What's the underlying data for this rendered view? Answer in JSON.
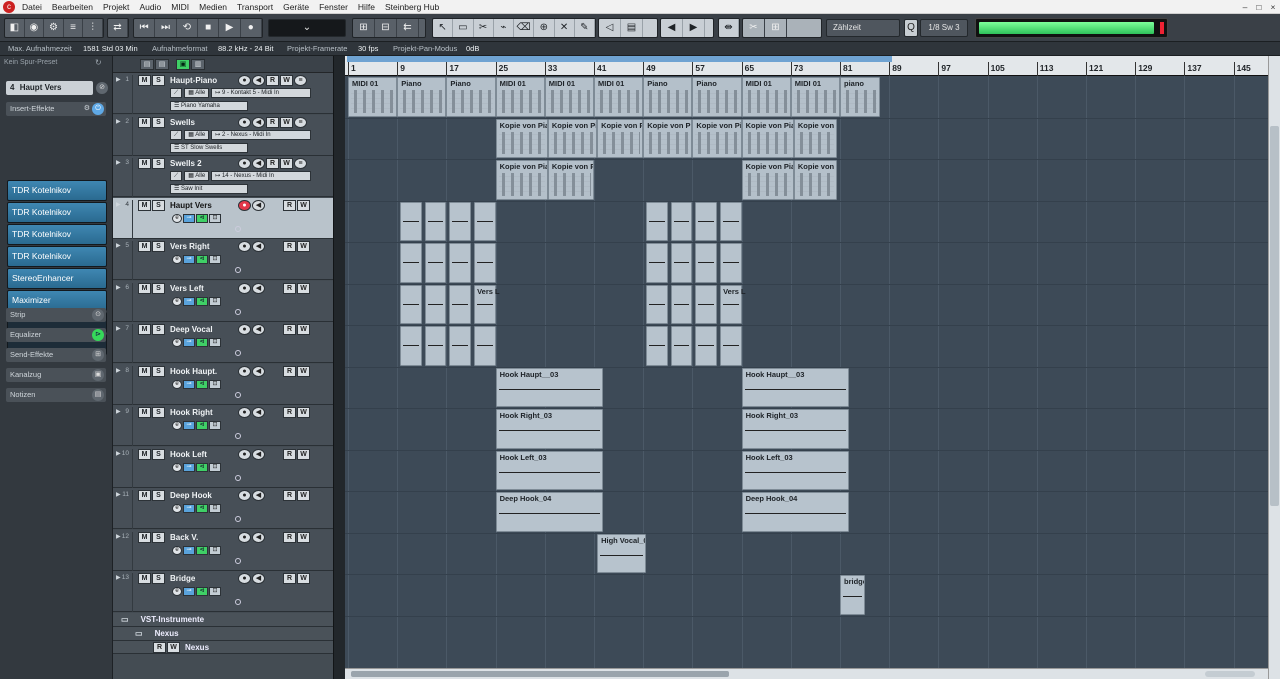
{
  "menubar": {
    "items": [
      "Datei",
      "Bearbeiten",
      "Projekt",
      "Audio",
      "MIDI",
      "Medien",
      "Transport",
      "Geräte",
      "Fenster",
      "Hilfe",
      "Steinberg Hub"
    ]
  },
  "toolbar": {
    "grid_type": "Zählzeit",
    "quantize": "1/8 Sw 3",
    "input_level_fraction": 0.97
  },
  "infoline": {
    "max_rec_label": "Max. Aufnahmezeit",
    "max_rec_value": "1581 Std 03 Min",
    "rec_format_label": "Aufnahmeformat",
    "rec_format_value": "88.2 kHz - 24 Bit",
    "framerate_label": "Projekt-Framerate",
    "framerate_value": "30 fps",
    "pan_mode_label": "Projekt-Pan-Modus",
    "pan_mode_value": "0dB"
  },
  "inspector": {
    "preset": "Kein Spur-Preset",
    "track_name": "Haupt Vers",
    "track_number": "4",
    "insert_label": "Insert-Effekte",
    "inserts": [
      "TDR Kotelnikov",
      "TDR Kotelnikov",
      "TDR Kotelnikov",
      "TDR Kotelnikov",
      "StereoEnhancer",
      "Maximizer",
      "",
      ""
    ],
    "sections": [
      "Strip",
      "Equalizer",
      "Send-Effekte",
      "Kanalzug",
      "Notizen"
    ]
  },
  "tracks": [
    {
      "num": "1",
      "name": "Haupt-Piano",
      "type": "instrument",
      "filter": "Alle",
      "routing": "9 - Kontakt 5 - Midi In",
      "patch": "Piano Yamaha"
    },
    {
      "num": "2",
      "name": "Swells",
      "type": "instrument",
      "filter": "Alle",
      "routing": "2 - Nexus - Midi In",
      "patch": "ST Slow Swells"
    },
    {
      "num": "3",
      "name": "Swells 2",
      "type": "instrument",
      "filter": "Alle",
      "routing": "14 - Nexus - Midi In",
      "patch": "Saw Init"
    },
    {
      "num": "4",
      "name": "Haupt Vers",
      "type": "audio",
      "selected": true,
      "rec": true
    },
    {
      "num": "5",
      "name": "Vers Right",
      "type": "audio"
    },
    {
      "num": "6",
      "name": "Vers Left",
      "type": "audio"
    },
    {
      "num": "7",
      "name": "Deep Vocal",
      "type": "audio"
    },
    {
      "num": "8",
      "name": "Hook Haupt.",
      "type": "audio"
    },
    {
      "num": "9",
      "name": "Hook Right",
      "type": "audio"
    },
    {
      "num": "10",
      "name": "Hook Left",
      "type": "audio"
    },
    {
      "num": "11",
      "name": "Deep Hook",
      "type": "audio"
    },
    {
      "num": "12",
      "name": "Back V.",
      "type": "audio"
    },
    {
      "num": "13",
      "name": "Bridge",
      "type": "audio"
    }
  ],
  "folders": {
    "vst_instruments": "VST-Instrumente",
    "nexus_folder": "Nexus",
    "nexus_track": "Nexus"
  },
  "ruler": [
    "1",
    "9",
    "17",
    "25",
    "33",
    "41",
    "49",
    "57",
    "65",
    "73",
    "81",
    "89",
    "97",
    "105",
    "113",
    "121",
    "129",
    "137",
    "145"
  ],
  "parts": {
    "piano": [
      {
        "name": "MIDI 01",
        "start": 1,
        "len": 8
      },
      {
        "name": "Piano",
        "start": 9,
        "len": 8
      },
      {
        "name": "Piano",
        "start": 17,
        "len": 8
      },
      {
        "name": "MIDI 01",
        "start": 25,
        "len": 8
      },
      {
        "name": "MIDI 01",
        "start": 33,
        "len": 8
      },
      {
        "name": "MIDI 01",
        "start": 41,
        "len": 8
      },
      {
        "name": "Piano",
        "start": 49,
        "len": 8
      },
      {
        "name": "Piano",
        "start": 57,
        "len": 8
      },
      {
        "name": "MIDI 01",
        "start": 65,
        "len": 8
      },
      {
        "name": "MIDI 01",
        "start": 73,
        "len": 8
      },
      {
        "name": "piano",
        "start": 81,
        "len": 6.5
      }
    ],
    "swells": [
      {
        "name": "Kopie von Pia",
        "start": 25,
        "len": 8.5
      },
      {
        "name": "Kopie von Pia",
        "start": 33.5,
        "len": 8
      },
      {
        "name": "Kopie von Pia",
        "start": 41.5,
        "len": 7.5
      },
      {
        "name": "Kopie von Pi",
        "start": 49,
        "len": 8
      },
      {
        "name": "Kopie von Pi",
        "start": 57,
        "len": 8
      },
      {
        "name": "Kopie von Pia",
        "start": 65,
        "len": 8.5
      },
      {
        "name": "Kopie von P",
        "start": 73.5,
        "len": 7
      }
    ],
    "swells2": [
      {
        "name": "Kopie von Pia",
        "start": 25,
        "len": 8.5
      },
      {
        "name": "Kopie von Pia",
        "start": 33.5,
        "len": 7.5
      },
      {
        "name": "Kopie von Pia",
        "start": 65,
        "len": 8.5
      },
      {
        "name": "Kopie von P",
        "start": 73.5,
        "len": 7
      }
    ],
    "verse_blocks": [
      {
        "start": 9.5,
        "len": 3.5
      },
      {
        "start": 13.5,
        "len": 3.5
      },
      {
        "start": 17.5,
        "len": 3.5
      },
      {
        "start": 21.5,
        "len": 3.5
      },
      {
        "start": 49.5,
        "len": 3.5
      },
      {
        "start": 53.5,
        "len": 3.5
      },
      {
        "start": 57.5,
        "len": 3.5
      },
      {
        "start": 61.5,
        "len": 3.5
      }
    ],
    "vers_left_labels": [
      {
        "name": "Vers L",
        "bar": 21.5
      },
      {
        "name": "Vers L",
        "bar": 61.5
      }
    ],
    "hook": [
      {
        "track": 8,
        "name": "Hook Haupt__03"
      },
      {
        "track": 9,
        "name": "Hook Right_03"
      },
      {
        "track": 10,
        "name": "Hook Left_03"
      },
      {
        "track": 11,
        "name": "Deep Hook_04"
      }
    ],
    "hook_starts": [
      25,
      65
    ],
    "hook_len": 17.5,
    "back_v": {
      "name": "High Vocal_0",
      "start": 41.5,
      "len": 8
    },
    "bridge": {
      "name": "bridge",
      "start": 81,
      "len": 4
    }
  }
}
